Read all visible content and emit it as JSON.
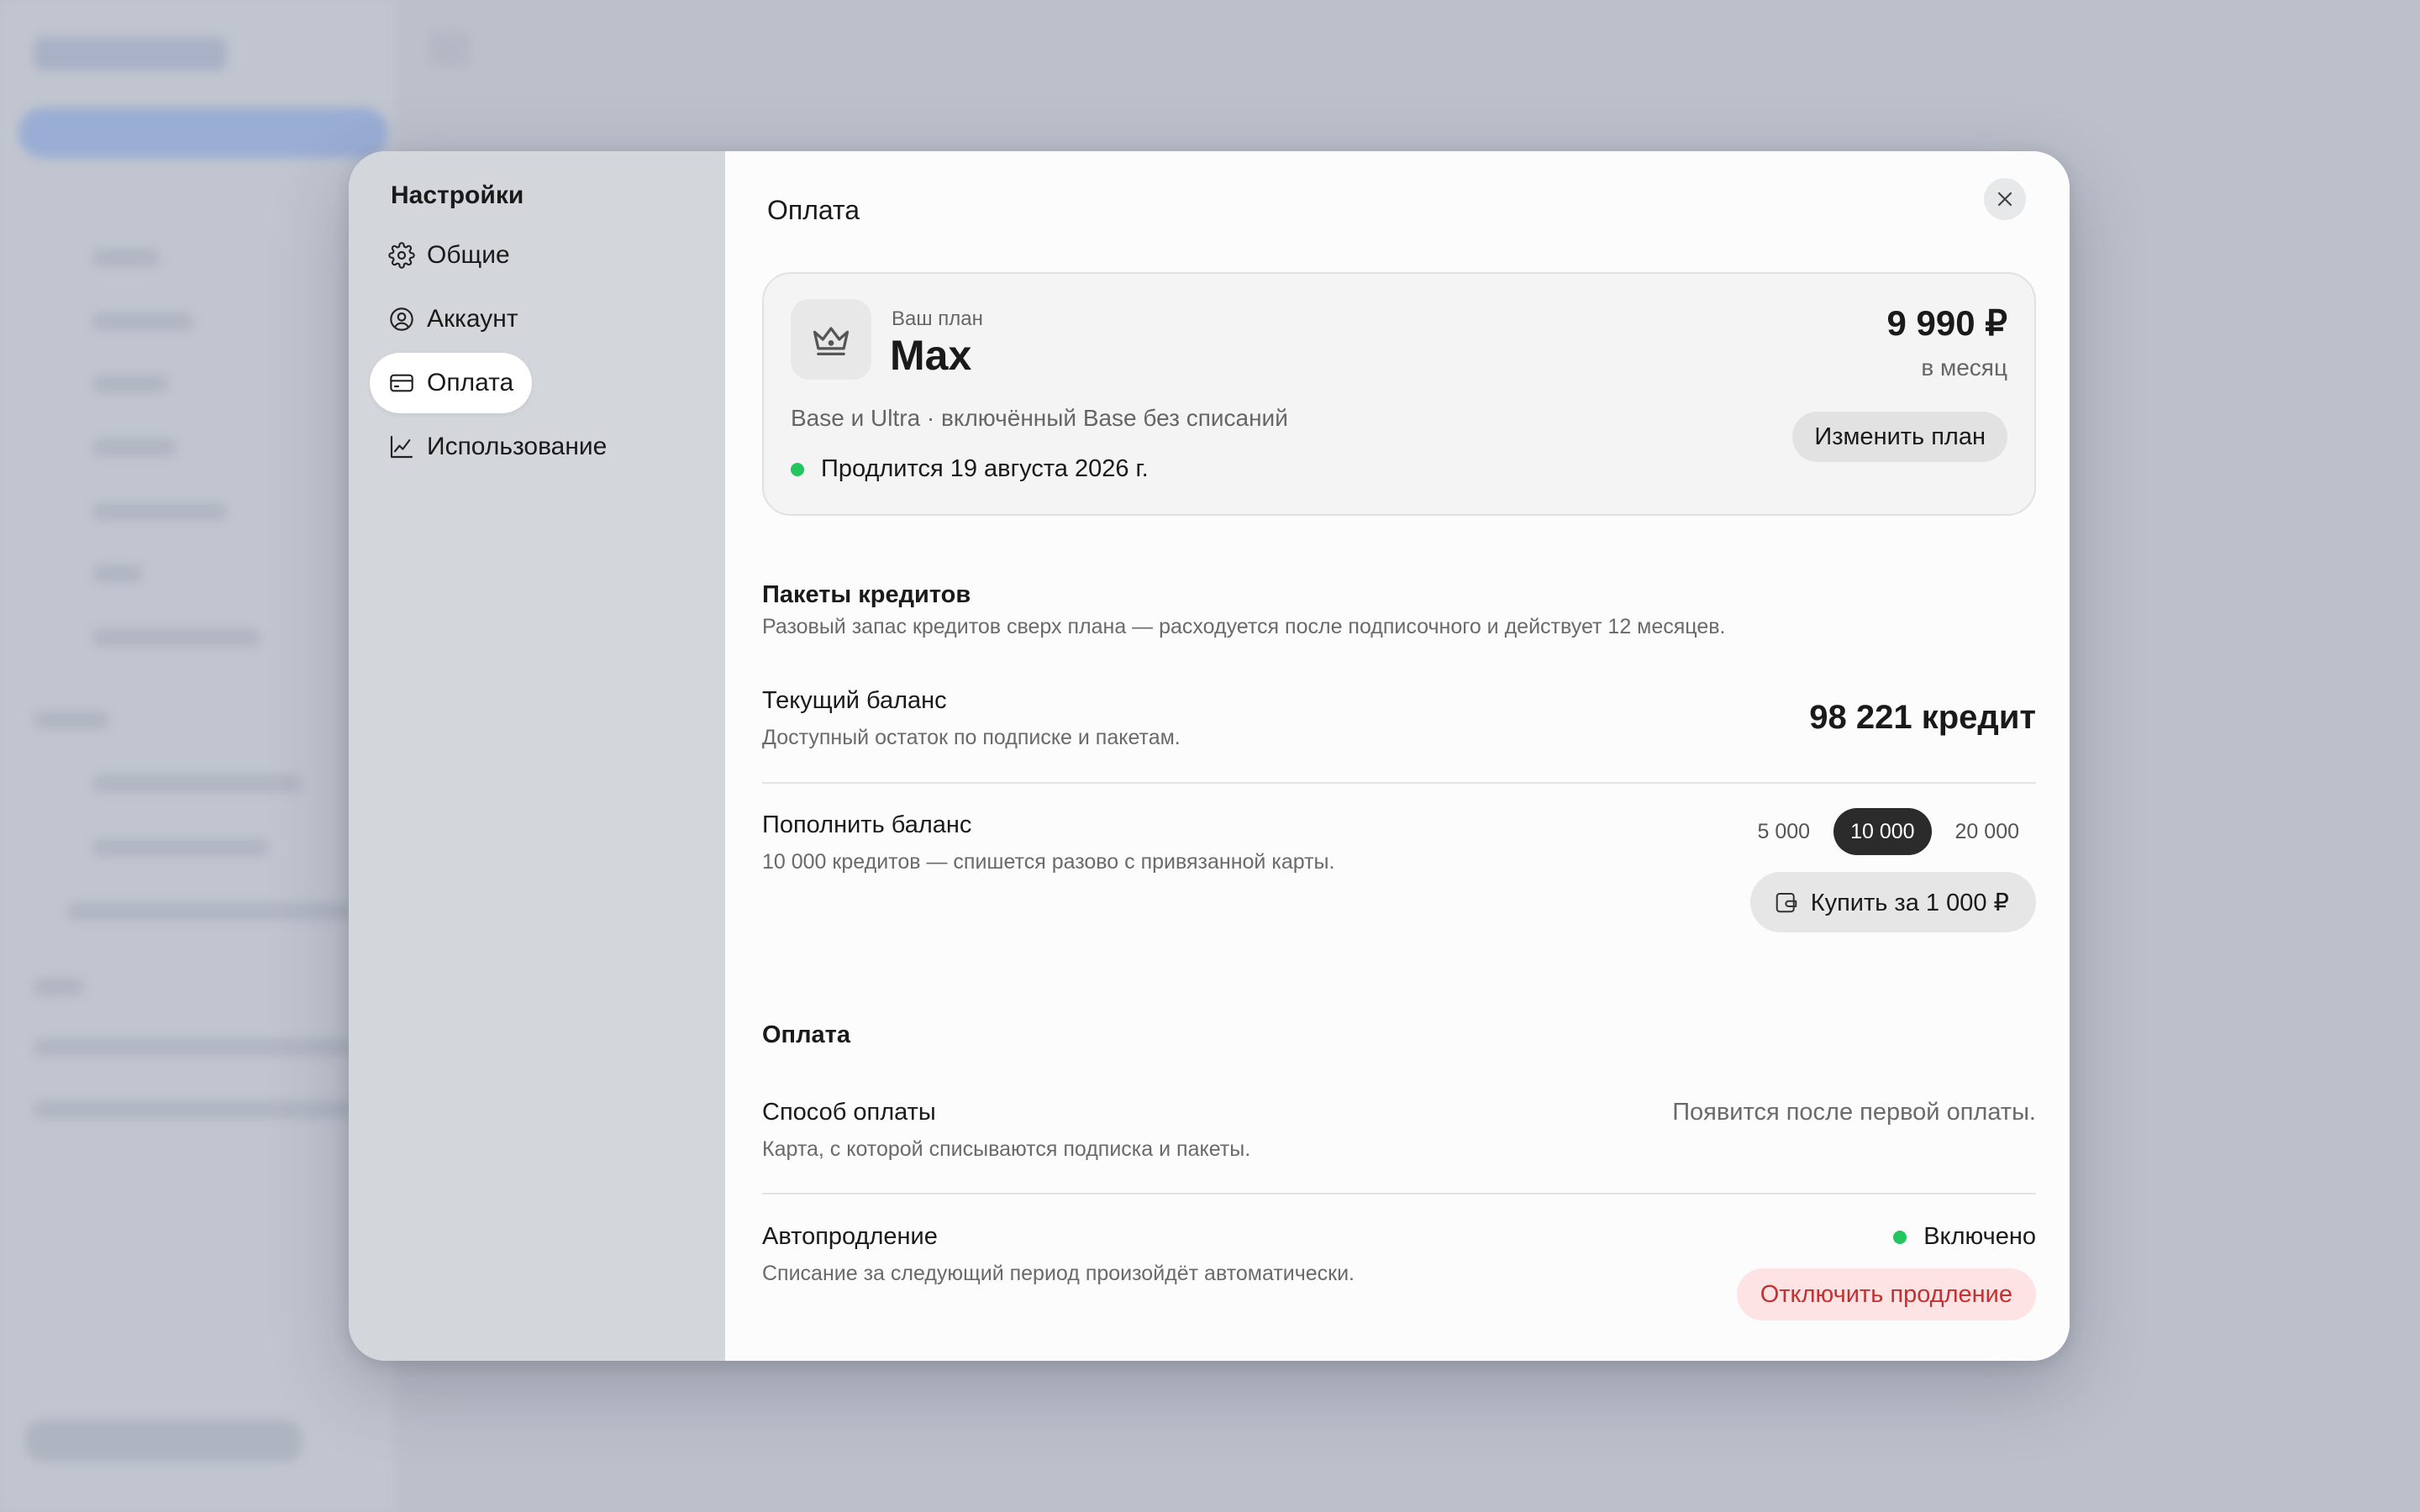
{
  "sidebar": {
    "title": "Настройки",
    "items": [
      {
        "label": "Общие",
        "icon": "gear-icon"
      },
      {
        "label": "Аккаунт",
        "icon": "user-circle-icon"
      },
      {
        "label": "Оплата",
        "icon": "credit-card-icon",
        "active": true
      },
      {
        "label": "Использование",
        "icon": "chart-line-icon"
      }
    ]
  },
  "main": {
    "title": "Оплата",
    "close_icon": "close-icon"
  },
  "plan": {
    "label": "Ваш план",
    "name": "Max",
    "price": "9 990 ₽",
    "period": "в месяц",
    "description": "Base и Ultra · включённый Base без списаний",
    "renewal": "Продлится 19 августа 2026 г.",
    "change_button": "Изменить план",
    "icon": "crown-icon"
  },
  "credits": {
    "title": "Пакеты кредитов",
    "subtitle": "Разовый запас кредитов сверх плана — расходуется после подписочного и действует 12 месяцев.",
    "balance_title": "Текущий баланс",
    "balance_sub": "Доступный остаток по подписке и пакетам.",
    "balance_value": "98 221 кредит",
    "topup_title": "Пополнить баланс",
    "topup_sub": "10 000 кредитов — спишется разово с привязанной карты.",
    "amounts": [
      "5 000",
      "10 000",
      "20 000"
    ],
    "selected_amount": "10 000",
    "buy_button": "Купить за 1 000 ₽",
    "buy_icon": "wallet-icon"
  },
  "payment": {
    "title": "Оплата",
    "method_title": "Способ оплаты",
    "method_sub": "Карта, с которой списываются подписка и пакеты.",
    "method_value": "Появится после первой оплаты.",
    "auto_title": "Автопродление",
    "auto_sub": "Списание за следующий период произойдёт автоматически.",
    "auto_status": "Включено",
    "disable_button": "Отключить продление"
  },
  "colors": {
    "status_green": "#22c55e",
    "danger_text": "#c53030",
    "danger_bg": "#fde3e3",
    "selected_chip": "#2b2b2b"
  }
}
